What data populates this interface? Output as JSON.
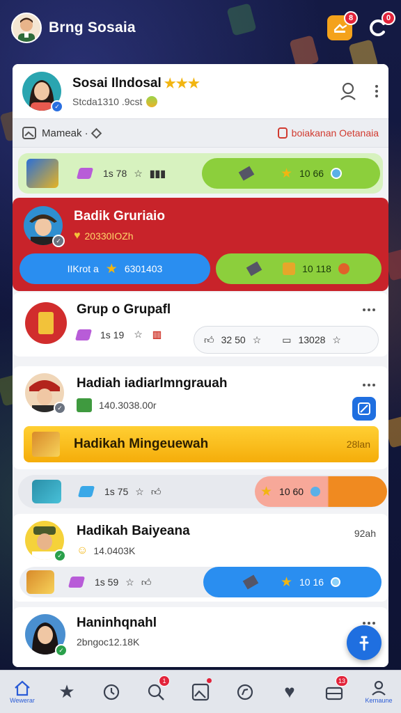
{
  "topbar": {
    "title": "Brng Sosaia",
    "gift_badge": "8",
    "chat_badge": "0"
  },
  "profile": {
    "name": "Sosai Ilndosal",
    "sub": "Stcda1310 .9cst"
  },
  "subbar": {
    "left": "Mameak ·",
    "right": "boiakanan Oetanaia"
  },
  "row1": {
    "stat": "1s 78",
    "reward": "10 66"
  },
  "featured": {
    "name": "Badik Gruriaio",
    "sub": "20330IOZh",
    "button": "IIKrot a",
    "button_value": "6301403",
    "reward": "10 118"
  },
  "group": {
    "title": "Grup o Grupafl",
    "stat": "1s 19",
    "count_a": "32 50",
    "count_b": "13028"
  },
  "hadiah": {
    "title": "Hadiah iadiarlmngrauah",
    "sub": "140.3038.00r",
    "banner": "Hadikah Mingeuewah",
    "banner_right": "28lan"
  },
  "row2": {
    "stat": "1s 75",
    "reward": "10 60"
  },
  "hadikah": {
    "title": "Hadikah Baiyeana",
    "sub": "14.0403K",
    "time": "92ah",
    "stat": "1s 59",
    "reward": "10 16"
  },
  "last": {
    "title": "Haninhqnahl",
    "sub": "2bngoc12.18K"
  },
  "nav": {
    "home_label": "Wewerar",
    "search_badge": "1",
    "gift_badge": "13",
    "profile_label": "Kernaune"
  }
}
